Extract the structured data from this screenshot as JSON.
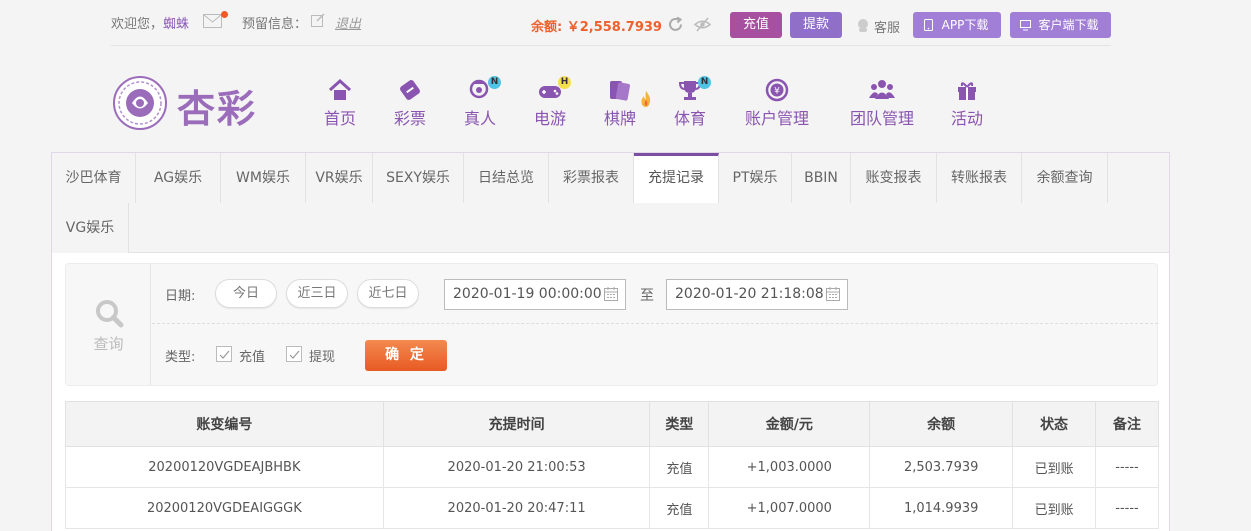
{
  "top": {
    "welcome": "欢迎您，",
    "username": "蜘蛛",
    "reserve_label": "预留信息：",
    "logout": "退出",
    "balance": "余额: ￥2,558.7939",
    "recharge_btn": "充值",
    "withdraw_btn": "提款",
    "service": "客服",
    "app_btn": "APP下载",
    "client_btn": "客户端下载"
  },
  "logo_text": "杏彩",
  "nav": [
    {
      "label": "首页",
      "icon": "home-icon"
    },
    {
      "label": "彩票",
      "icon": "lottery-icon"
    },
    {
      "label": "真人",
      "icon": "live-dealer-icon",
      "badge": "N"
    },
    {
      "label": "电游",
      "icon": "gamepad-icon",
      "badge": "H"
    },
    {
      "label": "棋牌",
      "icon": "cards-icon"
    },
    {
      "label": "体育",
      "icon": "trophy-icon",
      "badge": "N"
    },
    {
      "label": "账户管理",
      "icon": "account-icon"
    },
    {
      "label": "团队管理",
      "icon": "team-icon"
    },
    {
      "label": "活动",
      "icon": "gift-icon"
    }
  ],
  "tabs": [
    "沙巴体育",
    "AG娱乐",
    "WM娱乐",
    "VR娱乐",
    "SEXY娱乐",
    "日结总览",
    "彩票报表",
    "充提记录",
    "PT娱乐",
    "BBIN",
    "账变报表",
    "转账报表",
    "余额查询",
    "VG娱乐"
  ],
  "active_tab": "充提记录",
  "query": {
    "label": "查询",
    "date_label": "日期:",
    "today": "今日",
    "three_days": "近三日",
    "seven_days": "近七日",
    "start": "2020-01-19 00:00:00",
    "to": "至",
    "end": "2020-01-20 21:18:08",
    "type_label": "类型:",
    "type_recharge": "充值",
    "type_withdraw": "提现",
    "confirm": "确 定"
  },
  "table": {
    "headers": [
      "账变编号",
      "充提时间",
      "类型",
      "金额/元",
      "余额",
      "状态",
      "备注"
    ],
    "rows": [
      [
        "20200120VGDEAJBHBK",
        "2020-01-20 21:00:53",
        "充值",
        "+1,003.0000",
        "2,503.7939",
        "已到账",
        "-----"
      ],
      [
        "20200120VGDEAIGGGK",
        "2020-01-20 20:47:11",
        "充值",
        "+1,007.0000",
        "1,014.9939",
        "已到账",
        "-----"
      ]
    ]
  },
  "colors": {
    "brand": "#8a55b0",
    "accent": "#f0602c",
    "recharge": "#a7509f",
    "withdraw": "#8f6fc7"
  }
}
